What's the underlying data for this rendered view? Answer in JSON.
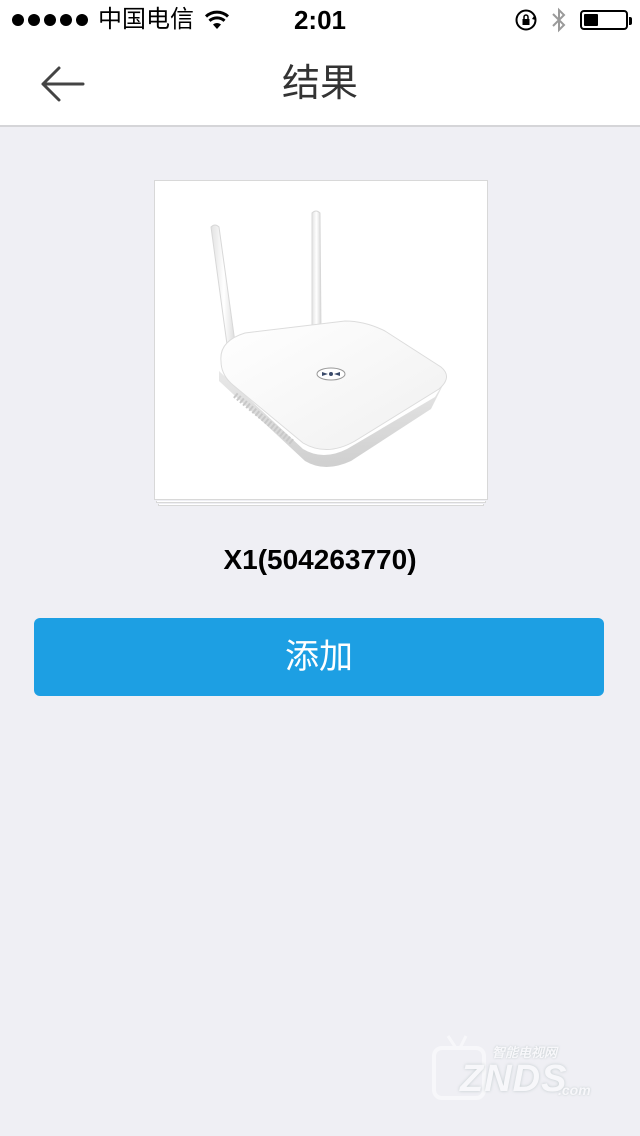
{
  "status_bar": {
    "carrier": "中国电信",
    "time": "2:01",
    "battery_level": 0.35
  },
  "nav": {
    "title": "结果",
    "back_icon": "arrow-left-icon"
  },
  "device": {
    "image_icon": "router-image",
    "name": "X1(504263770)"
  },
  "actions": {
    "add_label": "添加"
  },
  "watermark": {
    "sub": "智能电视网",
    "main": "ZNDS",
    "suffix": ".com"
  },
  "colors": {
    "accent": "#1d9fe3",
    "background": "#efeff4"
  }
}
